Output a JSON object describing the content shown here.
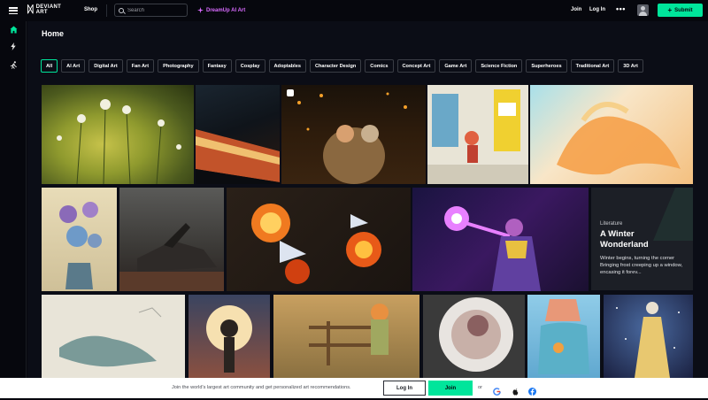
{
  "header": {
    "logo_text_1": "DEVIANT",
    "logo_text_2": "ART",
    "shop_label": "Shop",
    "search_placeholder": "Search",
    "dreamup_label": "DreamUp AI Art",
    "join_label": "Join",
    "login_label": "Log In",
    "more_label": "•••",
    "submit_label": "Submit"
  },
  "page": {
    "title": "Home"
  },
  "filters": [
    "All",
    "AI Art",
    "Digital Art",
    "Fan Art",
    "Photography",
    "Fantasy",
    "Cosplay",
    "Adoptables",
    "Character Design",
    "Comics",
    "Concept Art",
    "Game Art",
    "Science Fiction",
    "Superheroes",
    "Traditional Art",
    "3D Art"
  ],
  "featured": {
    "category": "Literature",
    "title": "A Winter Wonderland",
    "excerpt": "Winter begins, turning the corner Bringing frost creeping up a window, encasing it forev..."
  },
  "signup_bar": {
    "message": "Join the world's largest art community and get personalized art recommendations.",
    "login_label": "Log In",
    "join_label": "Join",
    "or_label": "or"
  },
  "colors": {
    "accent": "#00e59b",
    "dreamup": "#d86bff",
    "background": "#06070d"
  }
}
